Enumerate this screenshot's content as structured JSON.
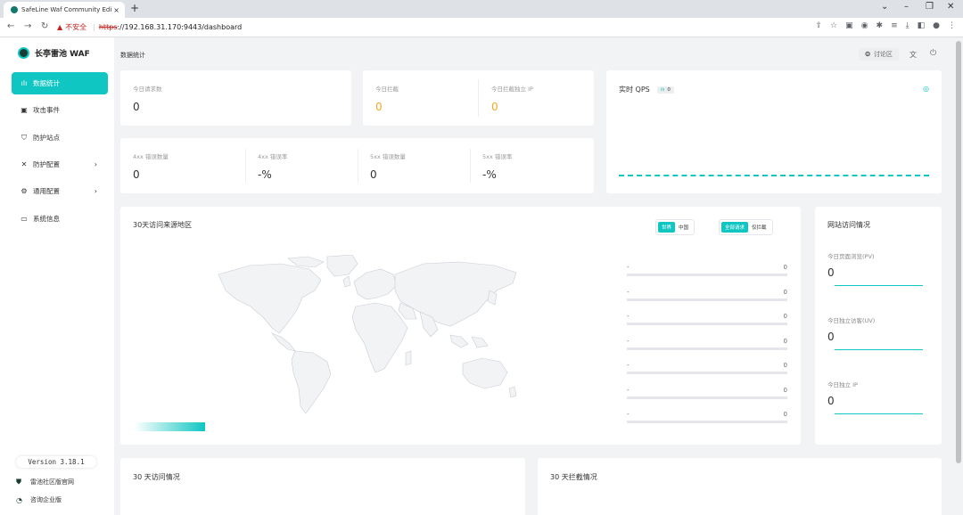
{
  "browser": {
    "tab_title": "SafeLine Waf Community Edi",
    "tab_close": "×",
    "new_tab": "+",
    "security_warning": "不安全",
    "url_scheme": "https",
    "url_rest": "://192.168.31.170:9443/dashboard"
  },
  "sidebar": {
    "logo_text": "长亭雷池 WAF",
    "items": [
      {
        "label": "数据统计",
        "icon": "bar-chart-icon",
        "glyph": "ılı",
        "has_children": false,
        "active": true
      },
      {
        "label": "攻击事件",
        "icon": "event-icon",
        "glyph": "▣",
        "has_children": false,
        "active": false
      },
      {
        "label": "防护站点",
        "icon": "shield-icon",
        "glyph": "⛉",
        "has_children": false,
        "active": false
      },
      {
        "label": "防护配置",
        "icon": "tools-icon",
        "glyph": "✕",
        "has_children": true,
        "active": false
      },
      {
        "label": "通用配置",
        "icon": "gear-icon",
        "glyph": "⚙",
        "has_children": true,
        "active": false
      },
      {
        "label": "系统信息",
        "icon": "monitor-icon",
        "glyph": "▭",
        "has_children": false,
        "active": false
      }
    ],
    "chevron": "›",
    "version": "Version 3.18.1",
    "footer_links": [
      {
        "label": "雷池社区版官网",
        "icon": "shield-logo-icon"
      },
      {
        "label": "咨询企业版",
        "icon": "headset-icon"
      }
    ]
  },
  "header": {
    "breadcrumb": "数据统计",
    "forum_label": "讨论区"
  },
  "stats_top": [
    {
      "label": "今日请求数",
      "value": "0"
    },
    {
      "label": "今日拦截",
      "value": "0"
    },
    {
      "label": "今日拦截独立 IP",
      "value": "0"
    }
  ],
  "stats_errors": [
    {
      "label": "4xx 错误数量",
      "value": "0"
    },
    {
      "label": "4xx 错误率",
      "value": "-%"
    },
    {
      "label": "5xx 错误数量",
      "value": "0"
    },
    {
      "label": "5xx 错误率",
      "value": "-%"
    }
  ],
  "qps": {
    "title": "实时 QPS",
    "badge": "0"
  },
  "geo": {
    "title": "30天访问来源地区",
    "scope_options": [
      "世界",
      "中国"
    ],
    "scope_selected": "世界",
    "filter_options": [
      "全部请求",
      "仅拦截"
    ],
    "filter_selected": "全部请求",
    "ranking": [
      {
        "name": "-",
        "count": "0"
      },
      {
        "name": "-",
        "count": "0"
      },
      {
        "name": "-",
        "count": "0"
      },
      {
        "name": "-",
        "count": "0"
      },
      {
        "name": "-",
        "count": "0"
      },
      {
        "name": "-",
        "count": "0"
      },
      {
        "name": "-",
        "count": "0"
      }
    ]
  },
  "site_visits": {
    "title": "网站访问情况",
    "metrics": [
      {
        "label": "今日页面浏览(PV)",
        "value": "0"
      },
      {
        "label": "今日独立访客(UV)",
        "value": "0"
      },
      {
        "label": "今日独立 IP",
        "value": "0"
      }
    ]
  },
  "bottom_cards": {
    "visits_title": "30 天访问情况",
    "blocks_title": "30 天拦截情况"
  },
  "colors": {
    "accent": "#0fc6c2",
    "warning": "#f5a623"
  }
}
